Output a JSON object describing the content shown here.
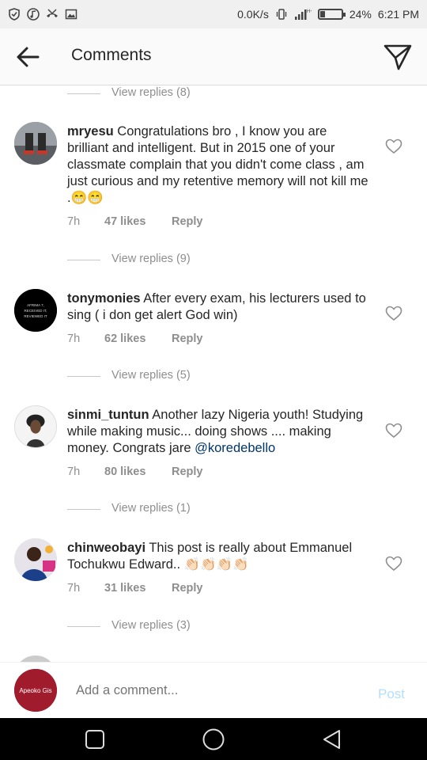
{
  "status_bar": {
    "net_speed": "0.0K/s",
    "battery_percent": "24%",
    "battery_level": 0.24,
    "time": "6:21 PM",
    "icons": [
      "shield-icon",
      "music-icon",
      "missed-call-icon",
      "image-icon",
      "vibrate-icon",
      "signal-icon",
      "battery-icon"
    ]
  },
  "header": {
    "title": "Comments",
    "back_icon": "arrow-left-icon",
    "share_icon": "send-icon"
  },
  "view_replies": [
    {
      "label": "View replies (8)"
    },
    {
      "label": "View replies (9)"
    },
    {
      "label": "View replies (5)"
    },
    {
      "label": "View replies (1)"
    },
    {
      "label": "View replies (3)"
    }
  ],
  "comments": [
    {
      "username": "mryesu",
      "text": "Congratulations bro , I know you are brilliant and intelligent. But in 2015 one of your classmate complain that you didn't come class , am just curious and my retentive memory will not kill me .😁😁",
      "time": "7h",
      "likes": "47 likes",
      "reply": "Reply"
    },
    {
      "username": "tonymonies",
      "text": "After every exam, his lecturers used to  sing ( i don get alert God win)",
      "time": "7h",
      "likes": "62 likes",
      "reply": "Reply"
    },
    {
      "username": "sinmi_tuntun",
      "text": "Another lazy Nigeria youth! Studying while making music... doing shows .... making money. Congrats jare",
      "mention": "@koredebello",
      "time": "7h",
      "likes": "80 likes",
      "reply": "Reply"
    },
    {
      "username": "chinweobayi",
      "text": "This post is really about Emmanuel Tochukwu Edward.. 👏🏻👏🏻👏🏻👏🏻",
      "time": "7h",
      "likes": "31 likes",
      "reply": "Reply"
    }
  ],
  "composer": {
    "placeholder": "Add a comment...",
    "post_label": "Post",
    "avatar_text": "Apeoko Gis"
  },
  "nav_bar": {
    "icons": [
      "recent-apps-icon",
      "home-icon",
      "back-icon"
    ]
  }
}
